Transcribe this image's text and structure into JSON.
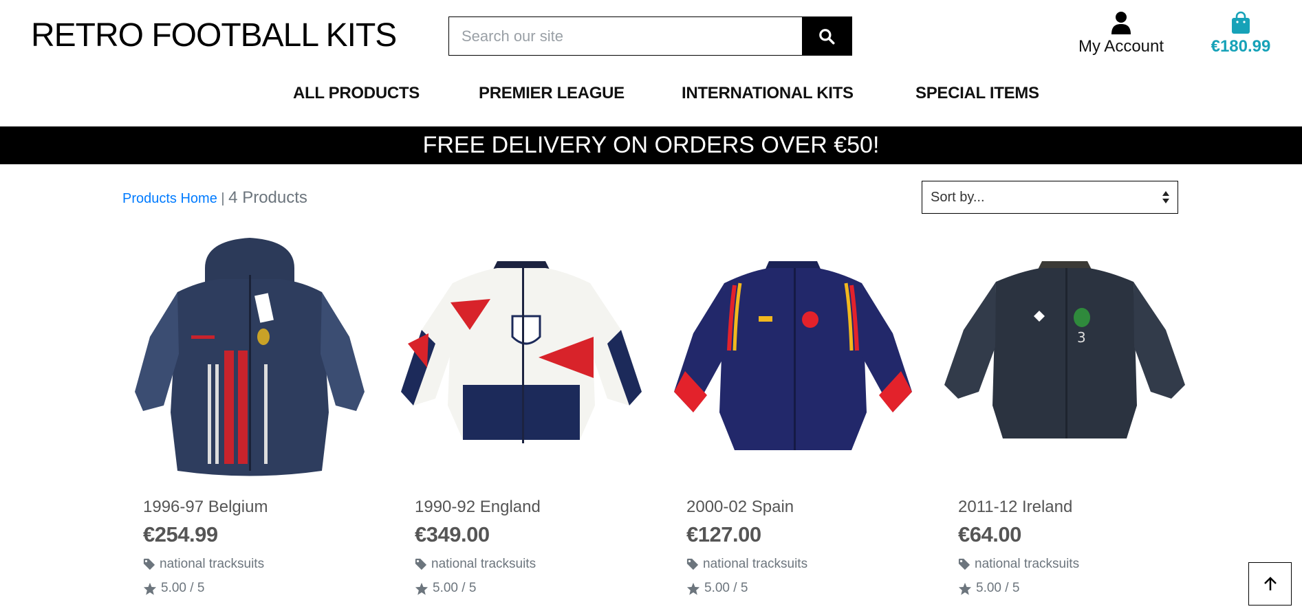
{
  "header": {
    "brand": "RETRO FOOTBALL KITS",
    "search": {
      "placeholder": "Search our site",
      "button_icon": "search-icon"
    },
    "account_label": "My Account",
    "cart_total": "€180.99",
    "cart_color": "#17a2b8"
  },
  "nav": {
    "items": [
      {
        "label": "ALL PRODUCTS"
      },
      {
        "label": "PREMIER LEAGUE"
      },
      {
        "label": "INTERNATIONAL KITS"
      },
      {
        "label": "SPECIAL ITEMS"
      }
    ]
  },
  "banner": {
    "text": "FREE DELIVERY ON ORDERS OVER €50!"
  },
  "listing": {
    "breadcrumb_link": "Products Home",
    "separator": "|",
    "count_label": "4 Products",
    "sort_placeholder": "Sort by..."
  },
  "products": [
    {
      "name": "1996-97 Belgium",
      "price": "€254.99",
      "category": "national tracksuits",
      "rating": "5.00 / 5"
    },
    {
      "name": "1990-92 England",
      "price": "€349.00",
      "category": "national tracksuits",
      "rating": "5.00 / 5"
    },
    {
      "name": "2000-02 Spain",
      "price": "€127.00",
      "category": "national tracksuits",
      "rating": "5.00 / 5"
    },
    {
      "name": "2011-12 Ireland",
      "price": "€64.00",
      "category": "national tracksuits",
      "rating": "5.00 / 5"
    }
  ],
  "colors": {
    "link": "#007bff",
    "banner_bg": "#000000",
    "banner_text": "#ffffff"
  }
}
